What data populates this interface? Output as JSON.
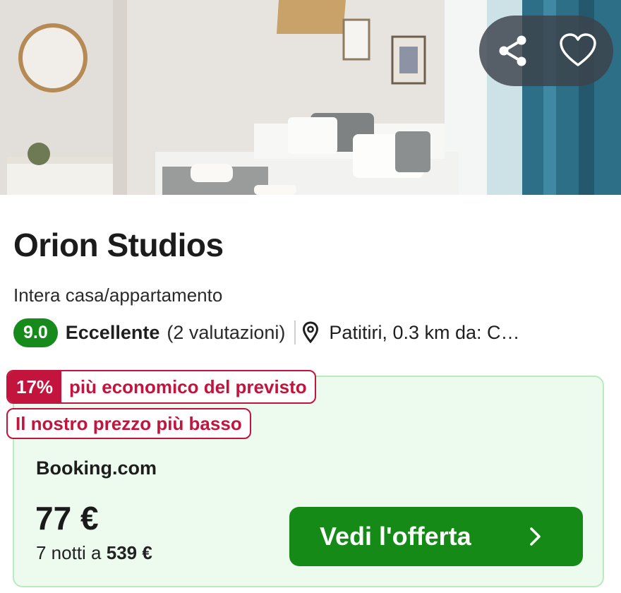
{
  "photo": {
    "alt_subject": ""
  },
  "actions": {
    "share_icon": "share-icon",
    "favorite_icon": "heart-icon"
  },
  "listing": {
    "title": "Orion Studios",
    "type": "Intera casa/appartamento",
    "score": "9.0",
    "rating_word": "Eccellente",
    "rating_count": "(2 valutazioni)",
    "location": "Patitiri, 0.3 km da: C…"
  },
  "deal": {
    "discount_pct": "17%",
    "discount_text": "più economico del previsto",
    "lowest_price_badge": "Il nostro prezzo più basso",
    "provider": "Booking.com",
    "price": "77 €",
    "nights_prefix": "7 notti a",
    "total_price": "539 €",
    "cta_label": "Vedi l'offerta"
  },
  "colors": {
    "score_green": "#168a1b",
    "cta_green": "#158a17",
    "badge_red": "#c2143c",
    "card_bg": "#ecfbee",
    "card_border": "#b8ebc0"
  }
}
